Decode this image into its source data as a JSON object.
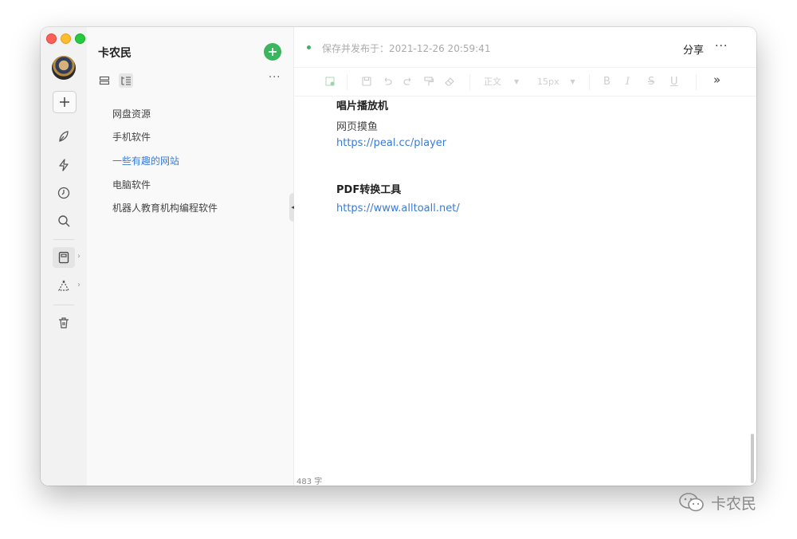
{
  "sidebar": {
    "icons": [
      "plus-icon",
      "pen-icon",
      "lightning-icon",
      "clock-icon",
      "search-icon",
      "notebook-icon",
      "tag-icon",
      "trash-icon"
    ]
  },
  "notebook": {
    "title": "卡农民",
    "more": "···",
    "items": [
      {
        "label": "网盘资源",
        "active": false
      },
      {
        "label": "手机软件",
        "active": false
      },
      {
        "label": "一些有趣的网站",
        "active": true
      },
      {
        "label": "电脑软件",
        "active": false
      },
      {
        "label": "机器人教育机构编程软件",
        "active": false
      }
    ]
  },
  "editor": {
    "save_status": "保存并发布于：2021-12-26 20:59:41",
    "share": "分享",
    "more": "···",
    "toolbar": {
      "paragraph": "正文",
      "font_size": "15px",
      "bold": "B",
      "italic": "I",
      "strike": "S",
      "underline": "U",
      "expand": "»"
    },
    "blocks": [
      {
        "type": "heading",
        "text": "唱片播放机"
      },
      {
        "type": "text",
        "text": "网页摸鱼"
      },
      {
        "type": "link",
        "text": "https://peal.cc/player"
      },
      {
        "type": "heading",
        "text": "PDF转换工具"
      },
      {
        "type": "link",
        "text": "https://www.alltoall.net/"
      }
    ],
    "word_count": "483 字"
  },
  "colors": {
    "accent": "#3bb55e",
    "link": "#3a7bd5"
  },
  "watermark": "卡农民"
}
